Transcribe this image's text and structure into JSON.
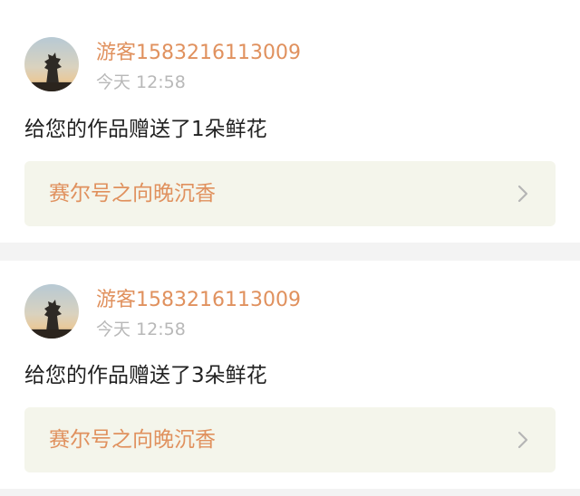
{
  "tab_indicator_color": "#e56c94",
  "colors": {
    "accent": "#e0915e",
    "timestamp": "#b8b8b8",
    "link_background": "#f4f5eb",
    "separator": "#f3f3f3"
  },
  "notifications": [
    {
      "avatar_icon": "avatar-image",
      "username": "游客1583216113009",
      "timestamp": "今天 12:58",
      "message": "给您的作品赠送了1朵鲜花",
      "work_title": "赛尔号之向晚沉香",
      "chevron_icon": "chevron-right-icon"
    },
    {
      "avatar_icon": "avatar-image",
      "username": "游客1583216113009",
      "timestamp": "今天 12:58",
      "message": "给您的作品赠送了3朵鲜花",
      "work_title": "赛尔号之向晚沉香",
      "chevron_icon": "chevron-right-icon"
    }
  ]
}
